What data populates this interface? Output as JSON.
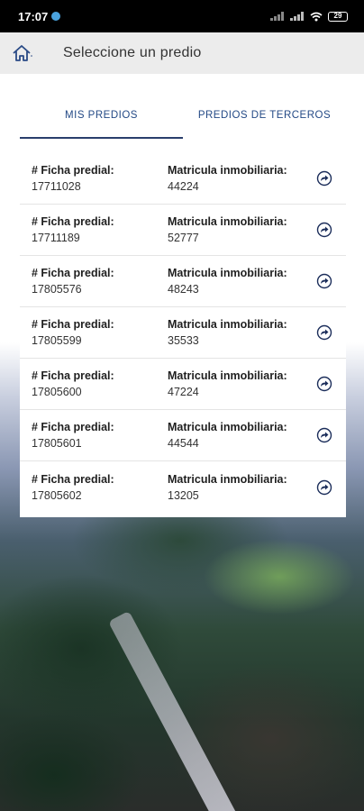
{
  "status": {
    "time": "17:07",
    "battery": "29",
    "notification_icon": "dot-icon"
  },
  "appbar": {
    "home_icon": "home-icon",
    "title": "Seleccione un predio"
  },
  "tabs": [
    {
      "label": "MIS PREDIOS",
      "active": true
    },
    {
      "label": "PREDIOS DE TERCEROS",
      "active": false
    }
  ],
  "list": {
    "ficha_label": "# Ficha predial:",
    "matricula_label": "Matricula inmobiliaria:",
    "arrow_icon": "share-arrow-icon",
    "rows": [
      {
        "ficha": "17711028",
        "matricula": "44224"
      },
      {
        "ficha": "17711189",
        "matricula": "52777"
      },
      {
        "ficha": "17805576",
        "matricula": "48243"
      },
      {
        "ficha": "17805599",
        "matricula": "35533"
      },
      {
        "ficha": "17805600",
        "matricula": "47224"
      },
      {
        "ficha": "17805601",
        "matricula": "44544"
      },
      {
        "ficha": "17805602",
        "matricula": "13205"
      }
    ]
  },
  "colors": {
    "accent": "#244a86",
    "tab_indicator": "#2a3e6c",
    "appbar_bg": "#ececec",
    "arrow_icon": "#1b2d5a"
  }
}
